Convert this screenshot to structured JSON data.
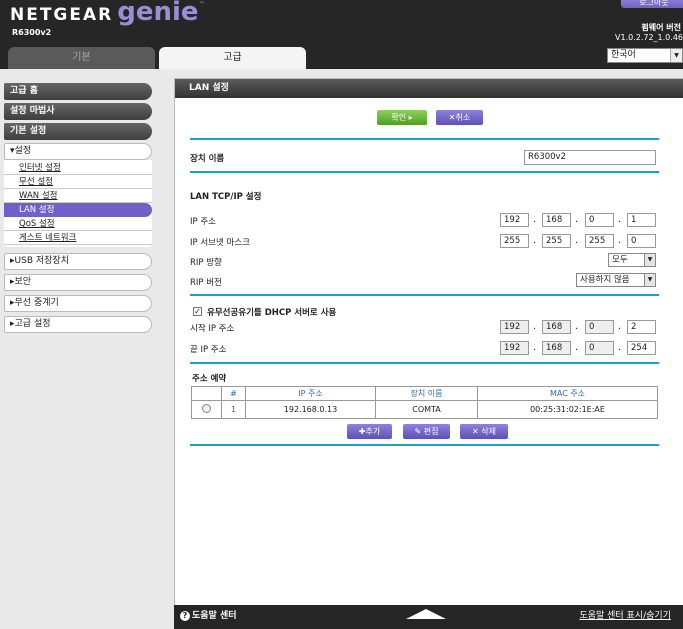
{
  "header": {
    "brand_primary": "NETGEAR",
    "brand_genie": "genie",
    "brand_tm": "™",
    "model": "R6300v2",
    "logout_label": "로그아웃",
    "firmware_label": "펌웨어 버전",
    "firmware_version": "V1.0.2.72_1.0.46"
  },
  "tabs": {
    "basic": "기본",
    "advanced": "고급"
  },
  "language": {
    "selected": "한국어"
  },
  "sidebar": {
    "advanced_home": "고급 홈",
    "setup_wizard": "설정 마법사",
    "wps_wizard": "기본 설정",
    "setup": "▾설정",
    "setup_items": [
      "인터넷 설정",
      "무선 설정",
      "WAN 설정",
      "LAN 설정",
      "QoS 설정",
      "게스트 네트워크"
    ],
    "usb_storage": "▸USB 저장장치",
    "security": "▸보안",
    "wireless_relay": "▸무선 중계기",
    "advanced_setup": "▸고급 설정"
  },
  "panel": {
    "title": "LAN 설정",
    "apply_label": "확인 ▸",
    "cancel_label": "✕취소",
    "device_name_label": "장치 이름",
    "device_name_value": "R6300v2",
    "tcpip_heading": "LAN TCP/IP 설정",
    "ip_label": "IP 주소",
    "ip": [
      "192",
      "168",
      "0",
      "1"
    ],
    "mask_label": "IP 서브넷 마스크",
    "mask": [
      "255",
      "255",
      "255",
      "0"
    ],
    "rip_dir_label": "RIP 방향",
    "rip_dir_value": "모두",
    "rip_ver_label": "RIP 버전",
    "rip_ver_value": "사용하지 않음",
    "dhcp_check": "✓",
    "dhcp_label": "유무선공유기를 DHCP 서버로 사용",
    "start_ip_label": "시작 IP 주소",
    "start_ip": [
      "192",
      "168",
      "0",
      "2"
    ],
    "end_ip_label": "끝 IP 주소",
    "end_ip": [
      "192",
      "168",
      "0",
      "254"
    ],
    "reservation_heading": "주소 예약",
    "table_headers": [
      "",
      "#",
      "IP 주소",
      "장치 이름",
      "MAC 주소"
    ],
    "rows": [
      {
        "num": "1",
        "ip": "192.168.0.13",
        "device": "COMTA",
        "mac": "00:25:31:02:1E:AE"
      }
    ],
    "add_label": "✚추가",
    "edit_label": "✎ 편집",
    "delete_label": "✕ 삭제"
  },
  "footer": {
    "help_icon": "?",
    "help_center": "도움말 센터",
    "help_toggle": "도움말 센터 표시/숨기기"
  },
  "colors": {
    "accent": "#6e62c8",
    "rule": "#1aa0c8",
    "apply": "#5aad2c",
    "header_bg": "#262626"
  }
}
